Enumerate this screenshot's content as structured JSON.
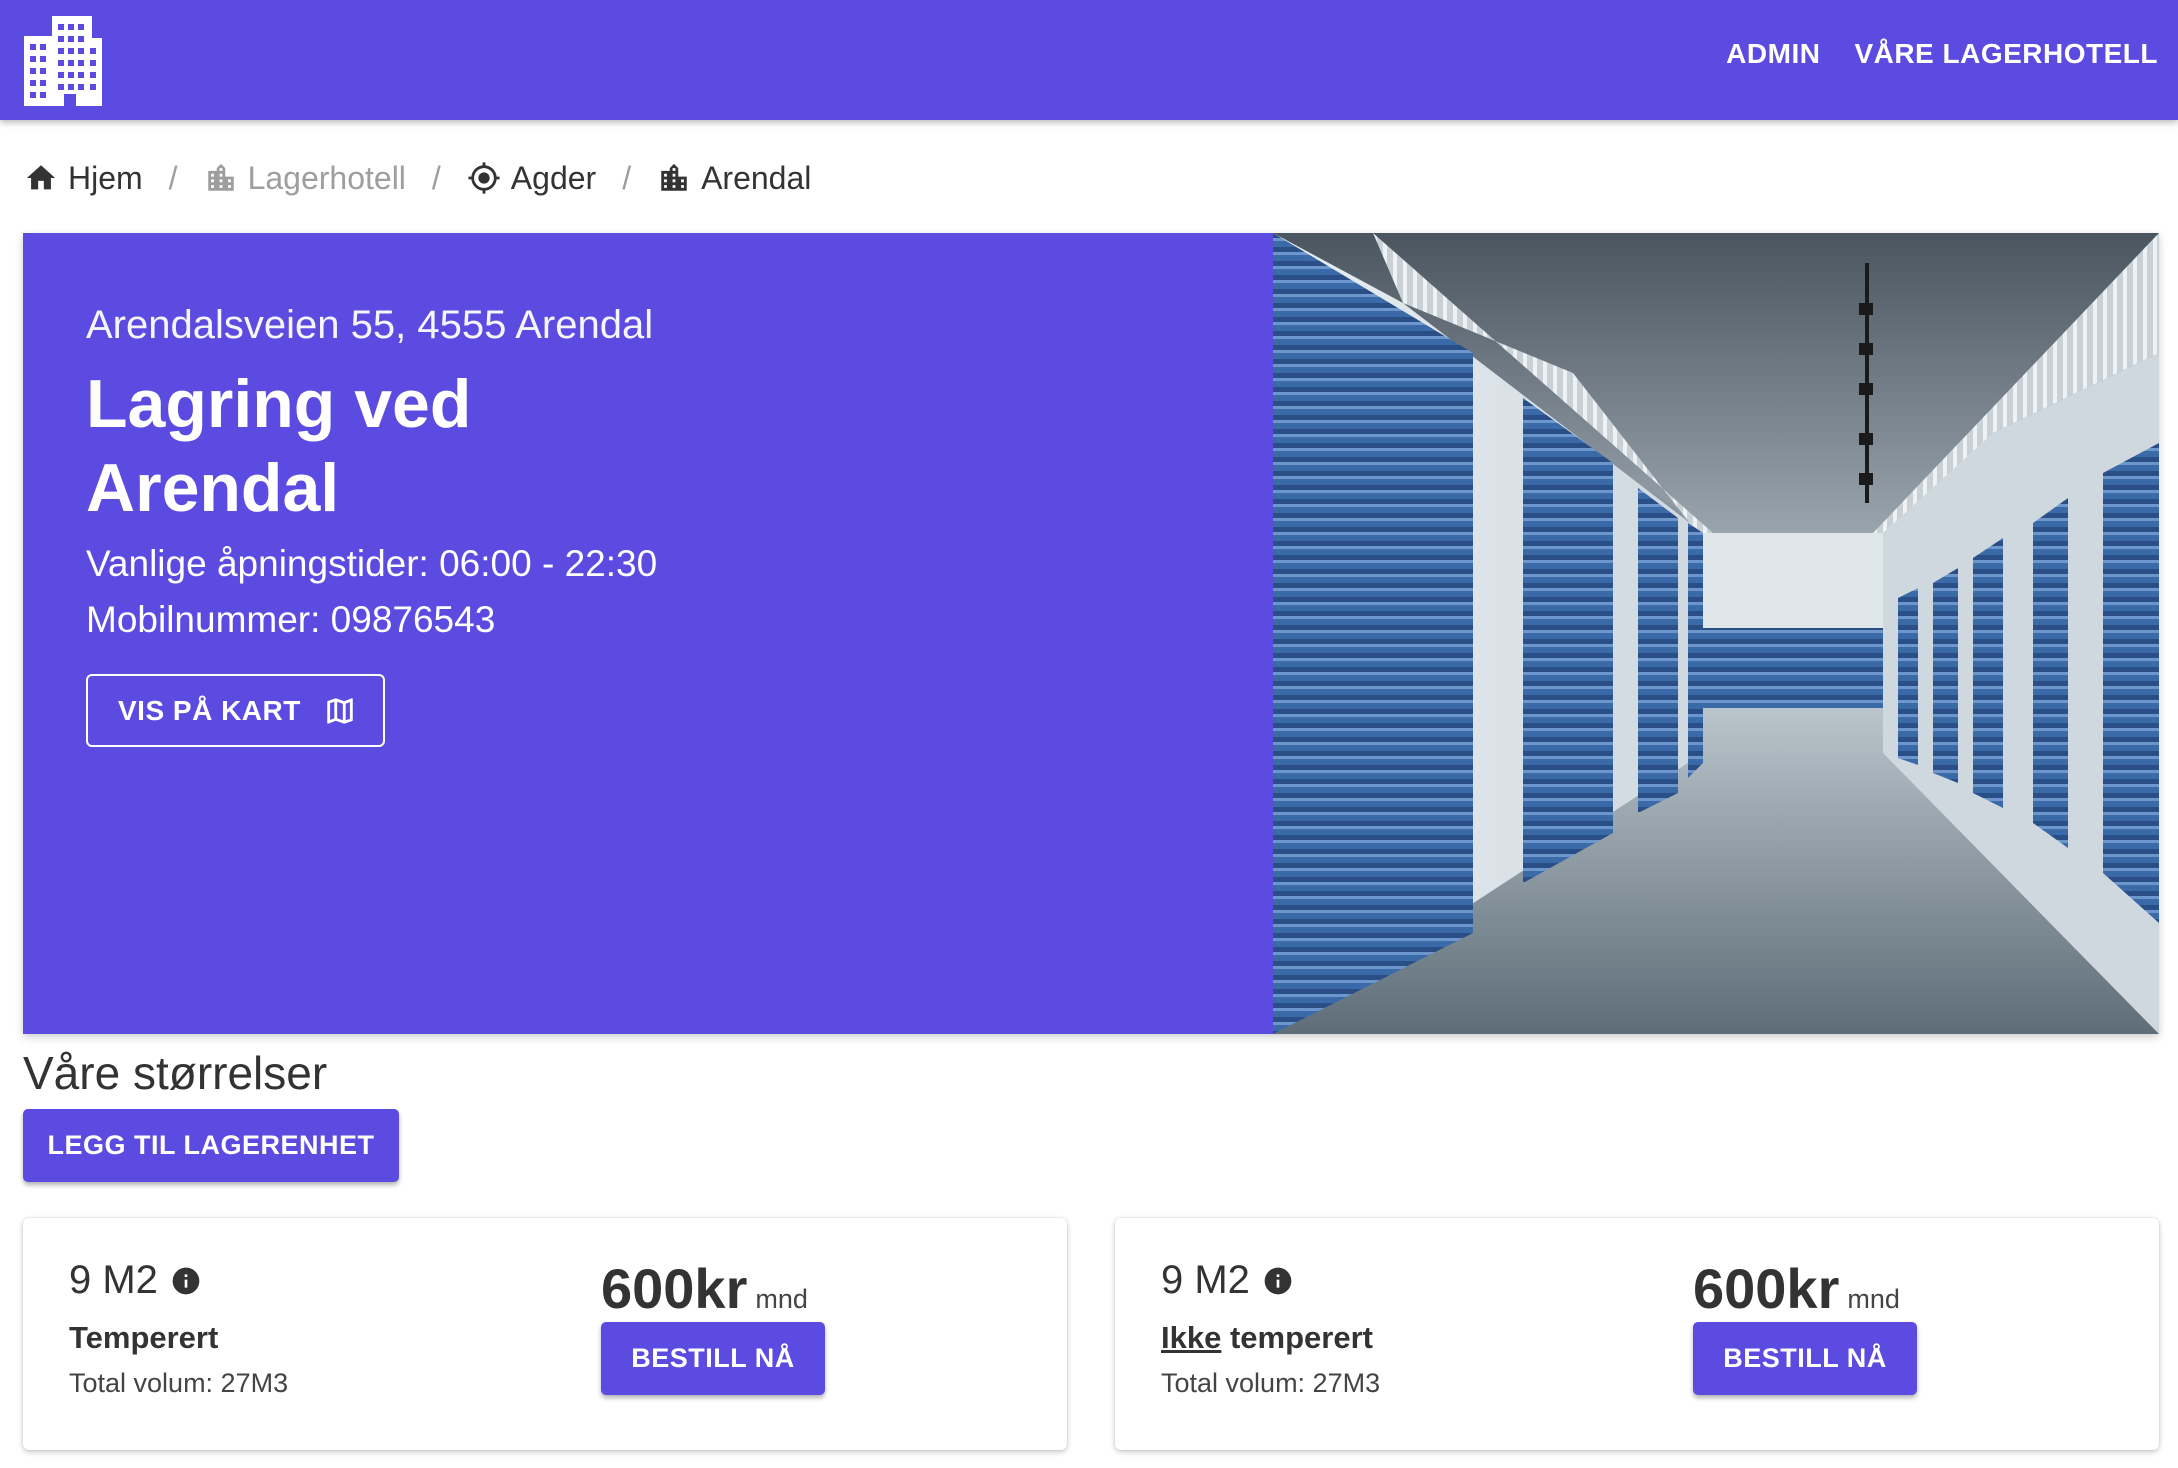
{
  "app": {
    "logo_icon": "building-icon",
    "nav": [
      "ADMIN",
      "VÅRE LAGERHOTELL"
    ]
  },
  "breadcrumb": {
    "items": [
      {
        "label": "Hjem",
        "icon": "home-icon"
      },
      {
        "label": "Lagerhotell",
        "icon": "building-icon"
      },
      {
        "label": "Agder",
        "icon": "location-icon"
      },
      {
        "label": "Arendal",
        "icon": "building-icon"
      }
    ],
    "separator": "/"
  },
  "hero": {
    "address": "Arendalsveien 55, 4555 Arendal",
    "title": "Lagring ved Arendal",
    "opening_hours": "Vanlige åpningstider: 06:00 - 22:30",
    "phone": "Mobilnummer: 09876543",
    "map_button": "VIS PÅ KART",
    "image_icon": "storage-corridor-image"
  },
  "sizes": {
    "title": "Våre størrelser",
    "add_button": "LEGG TIL LAGERENHET",
    "units": [
      {
        "size": "9 M2",
        "temperature_prefix": "",
        "temperature_underlined": "",
        "temperature": "Temperert",
        "volume": "Total volum: 27M3",
        "price": "600kr",
        "period": "mnd",
        "order_button": "BESTILL NÅ"
      },
      {
        "size": "9 M2",
        "temperature_prefix": "",
        "temperature_underlined": "Ikke",
        "temperature": " temperert",
        "volume": "Total volum: 27M3",
        "price": "600kr",
        "period": "mnd",
        "order_button": "BESTILL NÅ"
      }
    ]
  },
  "colors": {
    "primary": "#5b4be1",
    "white": "#ffffff",
    "text": "#333333"
  }
}
